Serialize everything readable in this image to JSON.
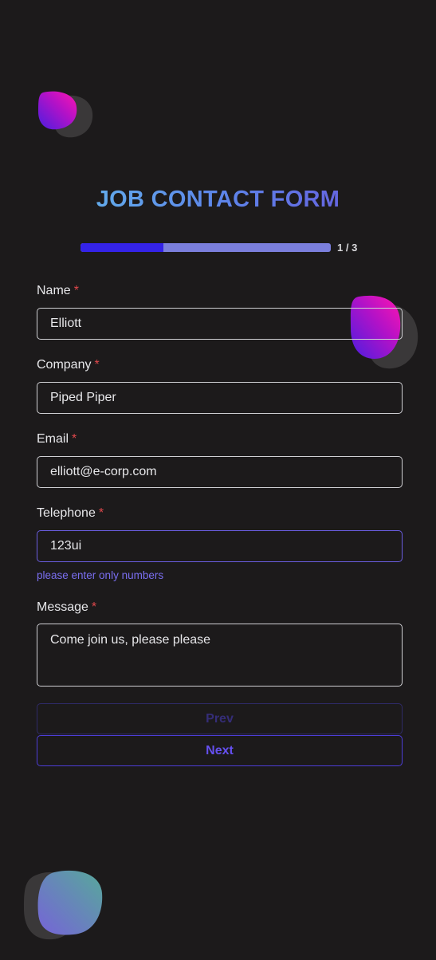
{
  "form": {
    "title": "JOB CONTACT FORM",
    "progress": {
      "fraction": 0.33,
      "text": "1 / 3"
    },
    "required_marker": "*",
    "fields": {
      "name": {
        "label": "Name",
        "value": "Elliott"
      },
      "company": {
        "label": "Company",
        "value": "Piped Piper"
      },
      "email": {
        "label": "Email",
        "value": "elliott@e-corp.com"
      },
      "telephone": {
        "label": "Telephone",
        "value": "123ui",
        "error": "please enter only numbers"
      },
      "message": {
        "label": "Message",
        "value": "Come join us, please please"
      }
    },
    "buttons": {
      "prev": "Prev",
      "next": "Next"
    }
  },
  "colors": {
    "background": "#1c1a1b",
    "accent": "#3423e8",
    "progress_track": "#7b7fdc",
    "error": "#7a6ef0",
    "required": "#e0484c",
    "blob_pink": "#e613b8",
    "blob_purple": "#5a1fd8",
    "blob_teal": "#5fa6a2"
  }
}
